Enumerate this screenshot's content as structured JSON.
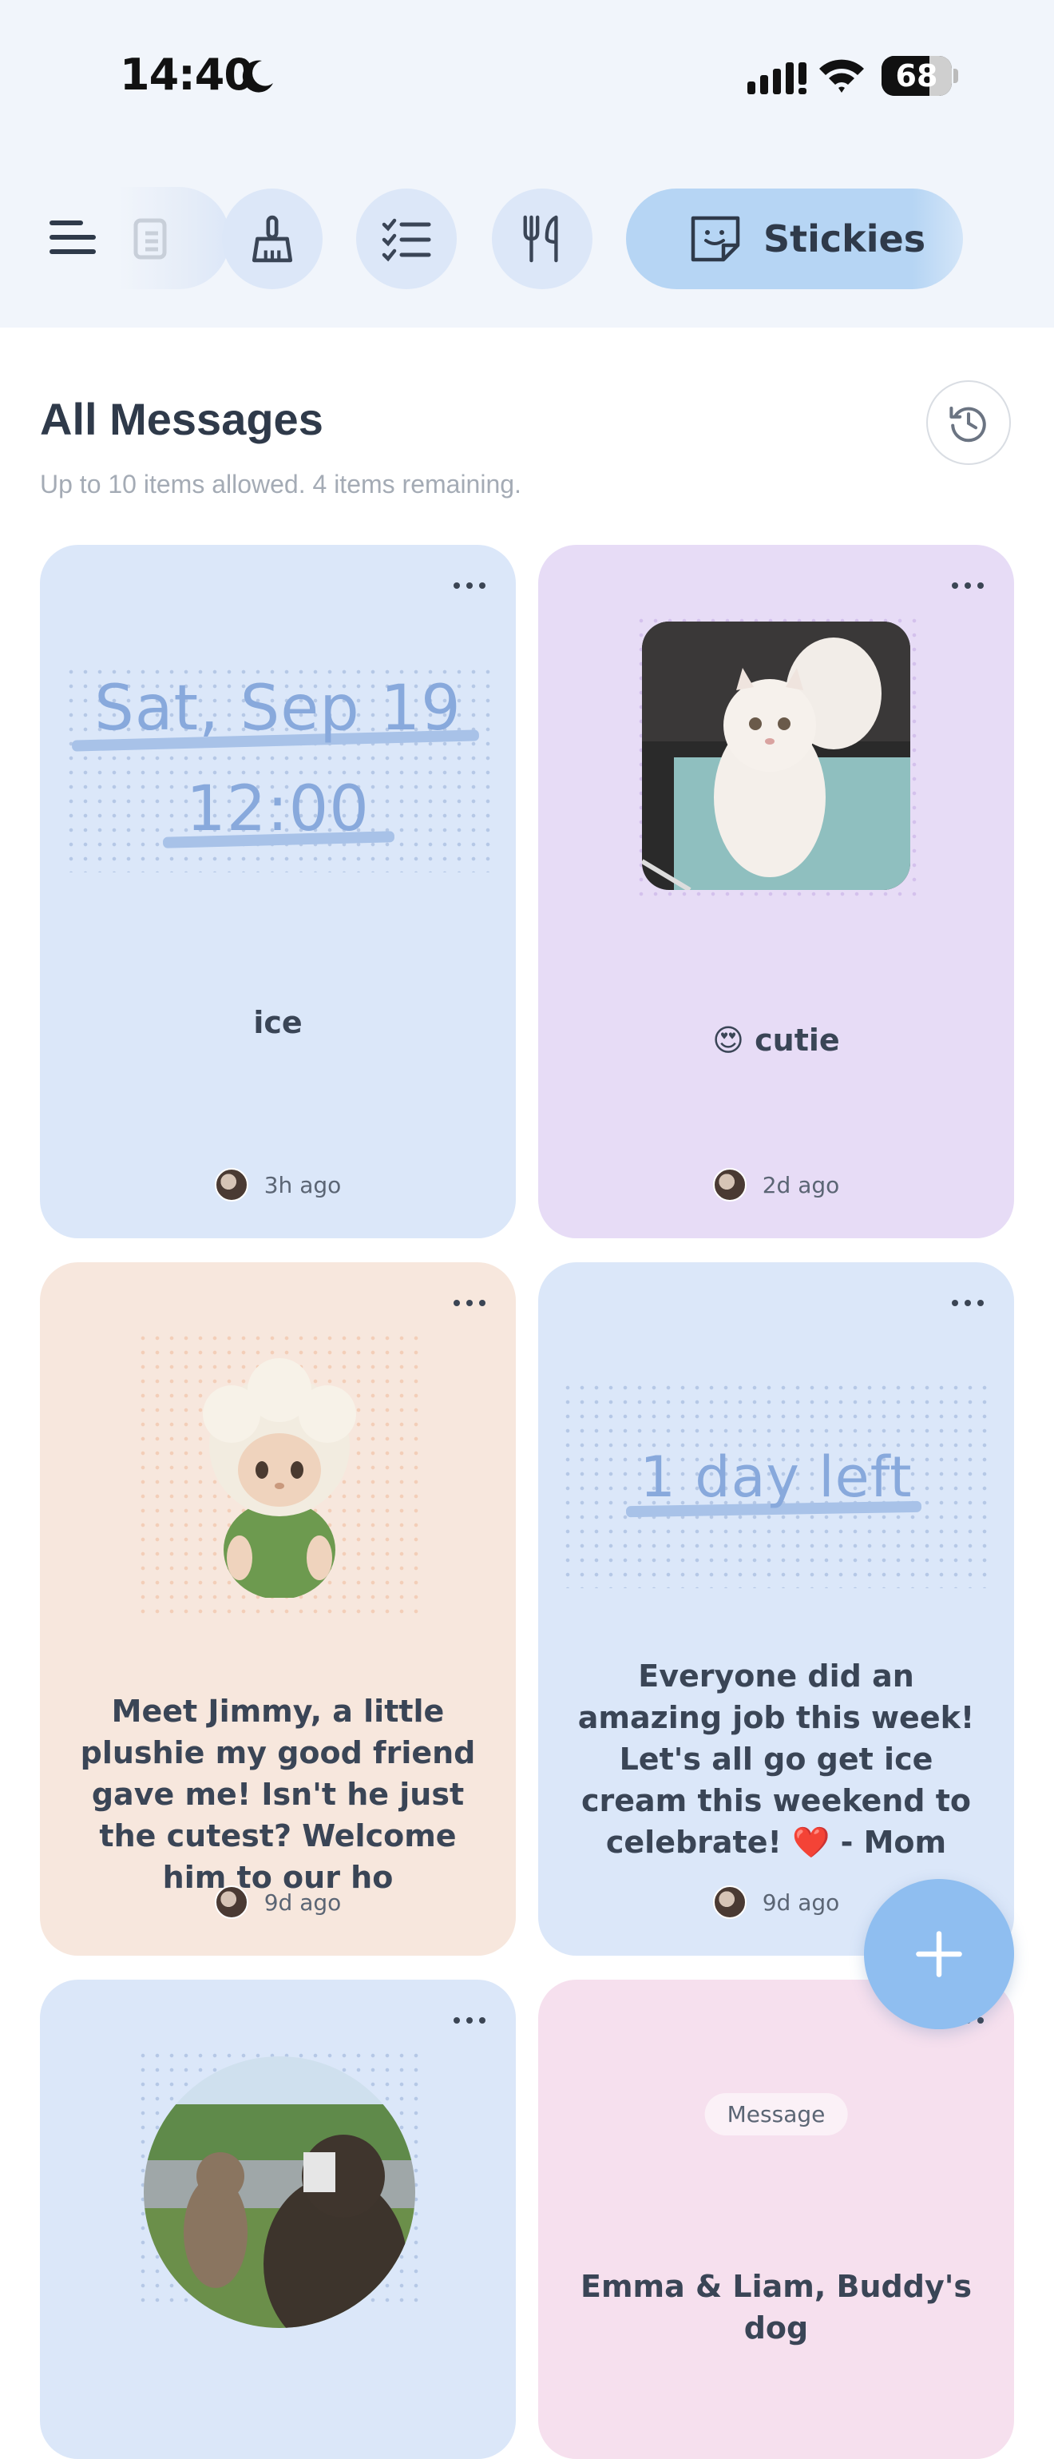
{
  "status_bar": {
    "time": "14:40",
    "battery": "68"
  },
  "tabs": {
    "active_label": "Stickies"
  },
  "header": {
    "title": "All Messages",
    "subtitle": "Up to 10 items allowed. 4 items remaining."
  },
  "cards": [
    {
      "date_line1": "Sat, Sep 19",
      "date_line2": "12:00",
      "message": "ice",
      "time_ago": "3h ago"
    },
    {
      "message_emoji": "😍",
      "message": "cutie",
      "time_ago": "2d ago"
    },
    {
      "message": "Meet Jimmy, a little plushie my good friend gave me! Isn't he just the cutest? Welcome him to our ho",
      "time_ago": "9d ago"
    },
    {
      "countdown": "1 day left",
      "message": "Everyone did an amazing job this week! Let's all go get ice cream this weekend to celebrate! ❤️  - Mom",
      "time_ago": "9d ago"
    },
    {},
    {
      "badge": "Message",
      "message": "Emma & Liam, Buddy's dog"
    }
  ],
  "icons": [
    "moon-icon",
    "signal-icon",
    "wifi-icon",
    "battery-icon",
    "menu-icon",
    "clipboard-icon",
    "broom-icon",
    "checklist-icon",
    "fork-knife-icon",
    "sticky-note-icon",
    "history-icon",
    "more-icon",
    "plus-icon"
  ],
  "colors": {
    "accent": "#8fbef0",
    "active_tab": "#b6d5f4",
    "card_blue": "#dbe7f9",
    "card_purple": "#e7dcf6",
    "card_peach": "#f7e7dd",
    "card_pink": "#f6e0ee"
  }
}
